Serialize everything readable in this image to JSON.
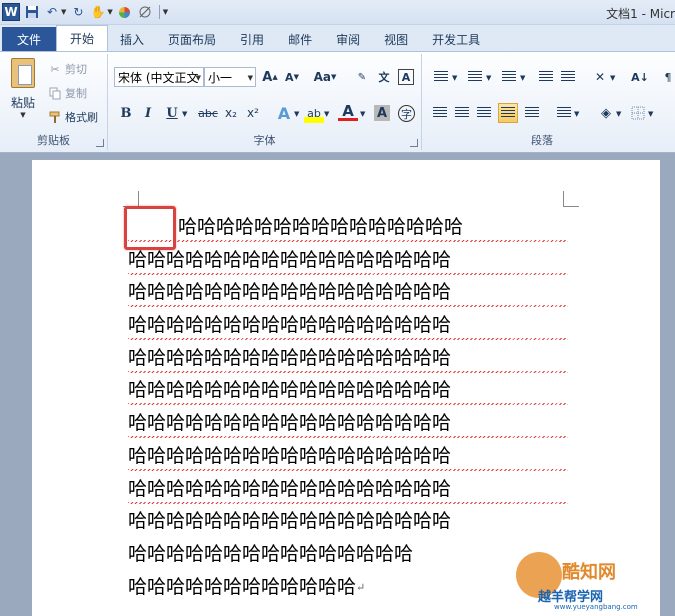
{
  "window": {
    "title": "文档1 - Micr",
    "app_logo": "W"
  },
  "tabs": {
    "file": "文件",
    "items": [
      "开始",
      "插入",
      "页面布局",
      "引用",
      "邮件",
      "审阅",
      "视图",
      "开发工具"
    ],
    "active": "开始"
  },
  "clipboard": {
    "paste_label": "粘贴",
    "cut_label": "剪切",
    "copy_label": "复制",
    "format_painter_label": "格式刷",
    "group_label": "剪贴板"
  },
  "font": {
    "font_name": "宋体 (中文正文",
    "font_size": "小一",
    "group_label": "字体",
    "grow_label": "A",
    "shrink_label": "A",
    "case_label": "Aa",
    "bold_label": "B",
    "italic_label": "I",
    "underline_label": "U",
    "strike_label": "abc",
    "subscript_label": "x₂",
    "superscript_label": "x²",
    "char_border_label": "A",
    "phonetic_label": "文",
    "enclose_label": "字"
  },
  "paragraph": {
    "group_label": "段落"
  },
  "document": {
    "lines": [
      "哈哈哈哈哈哈哈哈哈哈哈哈哈哈哈哈哈",
      "哈哈哈哈哈哈哈哈哈哈哈哈哈哈哈哈哈",
      "哈哈哈哈哈哈哈哈哈哈哈哈哈哈哈哈哈",
      "哈哈哈哈哈哈哈哈哈哈哈哈哈哈哈哈哈",
      "哈哈哈哈哈哈哈哈哈哈哈哈哈哈哈哈哈",
      "哈哈哈哈哈哈哈哈哈哈哈哈哈哈哈哈哈",
      "哈哈哈哈哈哈哈哈哈哈哈哈哈哈哈哈哈",
      "哈哈哈哈哈哈哈哈哈哈哈哈哈哈哈哈哈",
      "哈哈哈哈哈哈哈哈哈哈哈哈哈哈哈哈哈",
      "哈哈哈哈哈哈哈哈哈哈哈哈哈哈哈哈哈",
      "哈哈哈哈哈哈哈哈哈哈哈哈哈哈哈",
      "哈哈哈哈哈哈哈哈哈哈哈哈"
    ],
    "first_line": "哈哈哈哈哈哈哈哈哈哈哈哈哈哈哈",
    "paragraph_mark": "↵",
    "highlight_color": "#d9433f"
  },
  "watermark": {
    "name": "酷知网",
    "brand": "越羊帮学网",
    "url": "www.yueyangbang.com"
  },
  "colors": {
    "file_tab": "#2b579a",
    "spell_underline": "#e03a3a"
  }
}
